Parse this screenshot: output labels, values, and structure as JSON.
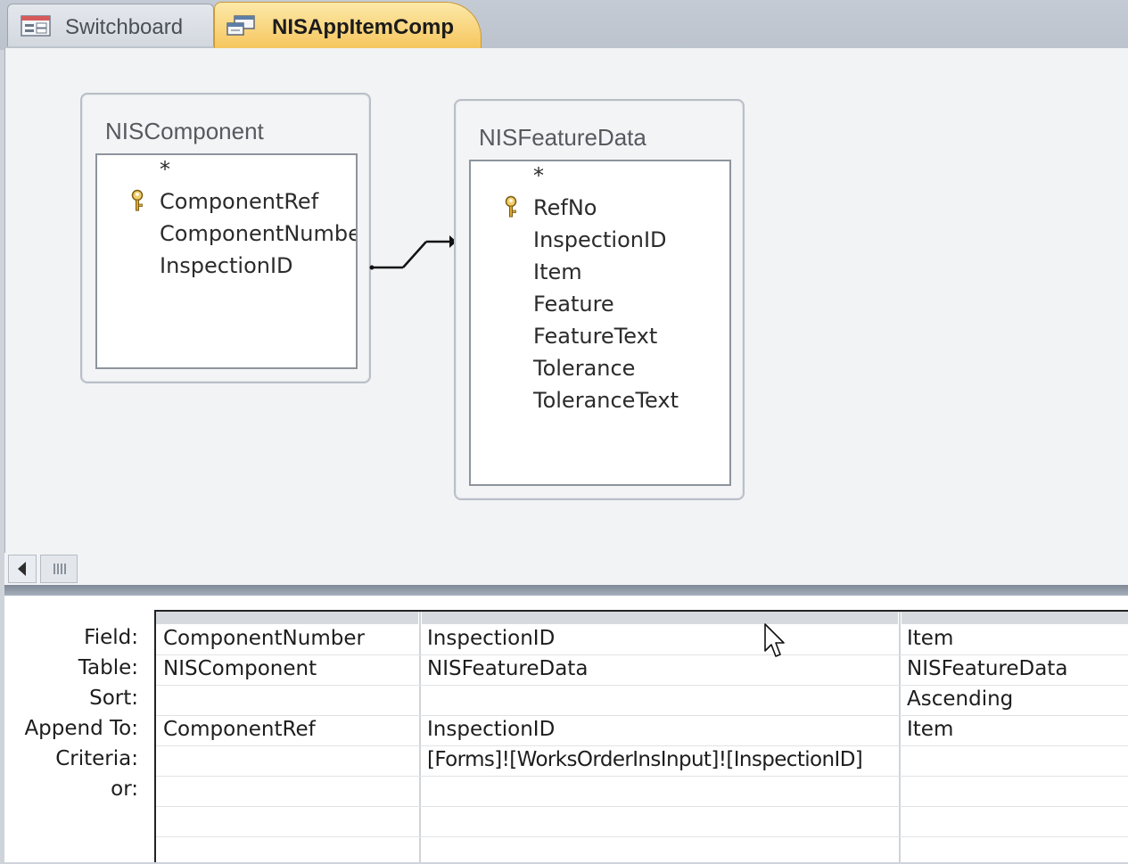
{
  "tabs": [
    {
      "label": "Switchboard",
      "icon": "form-icon",
      "active": false
    },
    {
      "label": "NISAppItemComp",
      "icon": "query-icon",
      "active": true
    }
  ],
  "tables": [
    {
      "title": "NISComponent",
      "fields": [
        "*",
        "ComponentRef",
        "ComponentNumbe",
        "InspectionID"
      ],
      "key_field": "ComponentRef"
    },
    {
      "title": "NISFeatureData",
      "fields": [
        "*",
        "RefNo",
        "InspectionID",
        "Item",
        "Feature",
        "FeatureText",
        "Tolerance",
        "ToleranceText"
      ],
      "key_field": "RefNo"
    }
  ],
  "grid": {
    "row_labels": [
      "Field:",
      "Table:",
      "Sort:",
      "Append To:",
      "Criteria:",
      "or:"
    ],
    "columns": [
      {
        "field": "ComponentNumber",
        "table": "NISComponent",
        "sort": "",
        "append_to": "ComponentRef",
        "criteria": "",
        "or": ""
      },
      {
        "field": "InspectionID",
        "table": "NISFeatureData",
        "sort": "",
        "append_to": "InspectionID",
        "criteria": "[Forms]![WorksOrderInsInput]![InspectionID]",
        "or": ""
      },
      {
        "field": "Item",
        "table": "NISFeatureData",
        "sort": "Ascending",
        "append_to": "Item",
        "criteria": "",
        "or": ""
      }
    ]
  },
  "colors": {
    "active_tab": "#f6c65e",
    "splitter": "#7e8896"
  }
}
